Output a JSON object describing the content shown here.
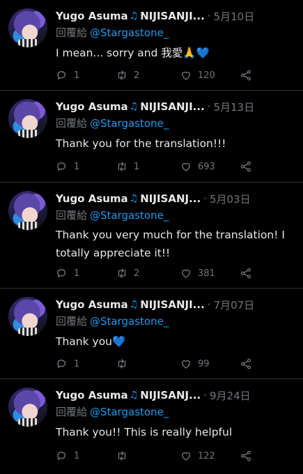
{
  "colors": {
    "background": "#000000",
    "text": "#e7e9ea",
    "muted": "#71767b",
    "link": "#1d9bf0",
    "divider": "#2f3336"
  },
  "icons": {
    "note": "music-note-icon",
    "reply": "reply-icon",
    "retweet": "retweet-icon",
    "like": "heart-icon",
    "share": "share-icon"
  },
  "tweets": [
    {
      "name": "Yugo Asuma",
      "handle": "NIJISANJI...",
      "date": "5月10日",
      "reply_prefix": "回覆給",
      "mention": "@Stargastone_",
      "text": "I mean... sorry and 我愛🙏💙",
      "replies": "1",
      "retweets": "2",
      "likes": "120"
    },
    {
      "name": "Yugo Asuma",
      "handle": "NIJISANJI...",
      "date": "5月13日",
      "reply_prefix": "回覆給",
      "mention": "@Stargastone_",
      "text": "Thank you for the translation!!!",
      "replies": "1",
      "retweets": "1",
      "likes": "693"
    },
    {
      "name": "Yugo Asuma",
      "handle": "NIJISANJ...",
      "date": "5月03日",
      "reply_prefix": "回覆給",
      "mention": "@Stargastone_",
      "text": "Thank you very much for the translation! I totally appreciate it!!",
      "replies": "1",
      "retweets": "2",
      "likes": "381"
    },
    {
      "name": "Yugo Asuma",
      "handle": "NIJISANJI...",
      "date": "7月07日",
      "reply_prefix": "回覆給",
      "mention": "@Stargastone_",
      "text": "Thank you💙",
      "replies": "1",
      "retweets": "",
      "likes": "99"
    },
    {
      "name": "Yugo Asuma",
      "handle": "NIJISANJ...",
      "date": "9月24日",
      "reply_prefix": "回覆給",
      "mention": "@Stargastone_",
      "text": "Thank you!! This is really helpful",
      "replies": "1",
      "retweets": "",
      "likes": "122"
    }
  ]
}
